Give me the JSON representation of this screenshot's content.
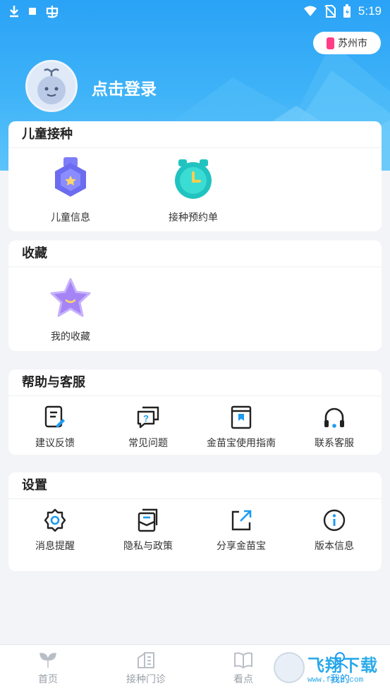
{
  "status_bar": {
    "time": "5:19"
  },
  "header": {
    "city": "苏州市",
    "login_text": "点击登录"
  },
  "sections": {
    "child_vaccination": {
      "title": "儿童接种",
      "items": [
        {
          "label": "儿童信息",
          "icon": "child-info-badge-icon"
        },
        {
          "label": "接种预约单",
          "icon": "appointment-clock-icon"
        }
      ]
    },
    "favorites": {
      "title": "收藏",
      "items": [
        {
          "label": "我的收藏",
          "icon": "star-icon"
        }
      ]
    },
    "help": {
      "title": "帮助与客服",
      "items": [
        {
          "label": "建议反馈",
          "icon": "feedback-icon"
        },
        {
          "label": "常见问题",
          "icon": "faq-icon"
        },
        {
          "label": "金苗宝使用指南",
          "icon": "guide-book-icon"
        },
        {
          "label": "联系客服",
          "icon": "headset-icon"
        }
      ]
    },
    "settings": {
      "title": "设置",
      "items": [
        {
          "label": "消息提醒",
          "icon": "gear-icon"
        },
        {
          "label": "隐私与政策",
          "icon": "privacy-doc-icon"
        },
        {
          "label": "分享金苗宝",
          "icon": "share-icon"
        },
        {
          "label": "版本信息",
          "icon": "info-icon"
        }
      ]
    }
  },
  "tabbar": {
    "tabs": [
      {
        "label": "首页",
        "icon": "sprout-icon"
      },
      {
        "label": "接种门诊",
        "icon": "clinic-icon"
      },
      {
        "label": "看点",
        "icon": "book-icon"
      },
      {
        "label": "我的",
        "icon": "profile-icon"
      }
    ]
  },
  "watermark": {
    "main": "飞翔下载",
    "sub": "www.fxxz.com"
  },
  "colors": {
    "hero_blue": "#2aa2f6",
    "accent_purple": "#6c6cf0",
    "accent_teal": "#2fd0c8",
    "city_pin": "#ff3d86"
  }
}
